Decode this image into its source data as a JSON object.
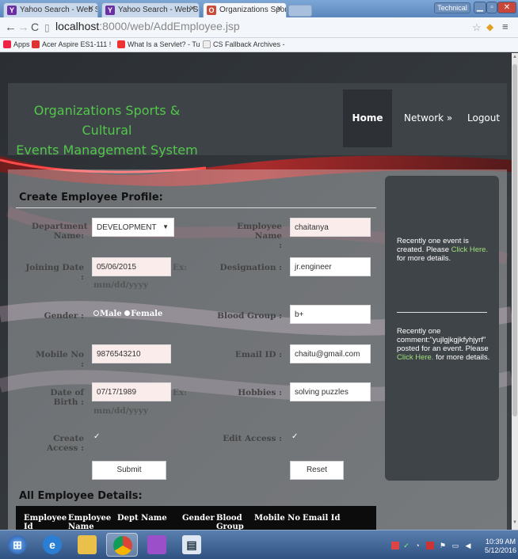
{
  "browser": {
    "tabs": [
      {
        "title": "Yahoo Search - Web Sear",
        "favicon": "Y"
      },
      {
        "title": "Yahoo Search - Web Sear",
        "favicon": "Y"
      },
      {
        "title": "Organizations Sports & C",
        "favicon": "O"
      }
    ],
    "user_badge": "Technical",
    "url_host": "localhost",
    "url_path": ":8000/web/AddEmployee.jsp",
    "bookmarks": [
      {
        "label": "Apps"
      },
      {
        "label": "Acer Aspire ES1-111 !"
      },
      {
        "label": "What Is a Servlet? - Tu"
      },
      {
        "label": "CS Fallback Archives -"
      }
    ]
  },
  "header": {
    "title_line1": "Organizations Sports & Cultural",
    "title_line2": "Events Management System",
    "nav": {
      "home": "Home",
      "network": "Network »",
      "logout": "Logout"
    }
  },
  "form": {
    "section_title": "Create Employee Profile:",
    "department": {
      "label_line1": "Department",
      "label_line2": "Name:",
      "value": "DEVELOPMENT"
    },
    "employee_name": {
      "label_line1": "Employee Name",
      "label_line2": ":",
      "value": "chaitanya"
    },
    "joining_date": {
      "label": "Joining Date :",
      "value": "05/06/2015",
      "hint": "Ex:",
      "format": "mm/dd/yyyy"
    },
    "designation": {
      "label": "Designation :",
      "value": "jr.engineer"
    },
    "gender": {
      "label": "Gender :",
      "male": "Male",
      "female": "Female",
      "selected": "Female"
    },
    "blood_group": {
      "label": "Blood Group :",
      "value": "b+"
    },
    "mobile": {
      "label": "Mobile No :",
      "value": "9876543210"
    },
    "email": {
      "label": "Email ID :",
      "value": "chaitu@gmail.com"
    },
    "dob": {
      "label": "Date of Birth :",
      "value": "07/17/1989",
      "hint": "Ex:",
      "format": "mm/dd/yyyy"
    },
    "hobbies": {
      "label": "Hobbies :",
      "value": "solving puzzles"
    },
    "create_access": {
      "label": "Create Access :",
      "checked": true,
      "mark": "✓"
    },
    "edit_access": {
      "label": "Edit Access :",
      "checked": true,
      "mark": "✓"
    },
    "submit_label": "Submit",
    "reset_label": "Reset"
  },
  "sidebar": {
    "notice1_pre": "Recently one event is created. Please ",
    "notice1_link": "Click Here.",
    "notice1_post": " for more details.",
    "notice2_pre": "Recently one comment:\"yujlgjkgjkfyhjyrf\" posted for an event. Please ",
    "notice2_link": "Click Here.",
    "notice2_post": " for more details."
  },
  "employee_table": {
    "section_title": "All Employee Details:",
    "columns": [
      {
        "line1": "Employee",
        "line2": "Id"
      },
      {
        "line1": "Employee",
        "line2": "Name"
      },
      {
        "line1": "Dept Name",
        "line2": ""
      },
      {
        "line1": "Gender",
        "line2": ""
      },
      {
        "line1": "Blood",
        "line2": "Group"
      },
      {
        "line1": "Mobile No",
        "line2": ""
      },
      {
        "line1": "Email Id",
        "line2": ""
      }
    ]
  },
  "taskbar": {
    "time": "10:39 AM",
    "date": "5/12/2016"
  },
  "colors": {
    "title_green": "#52c74a",
    "link_green": "#9fe07a",
    "header_bg": "#3e4347",
    "taskbar_blue": "#2f5282"
  }
}
